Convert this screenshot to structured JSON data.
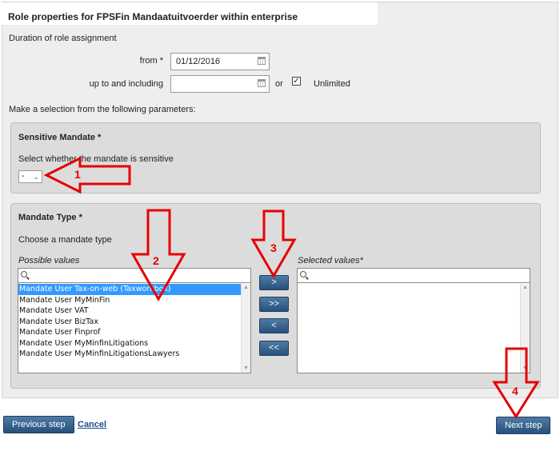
{
  "header": {
    "title": "Role properties for FPSFin Mandaatuitvoerder within enterprise"
  },
  "duration": {
    "label": "Duration of role assignment",
    "from_label": "from *",
    "from_value": "01/12/2016",
    "until_label": "up to and including",
    "until_value": "",
    "or_label": "or",
    "unlimited_label": "Unlimited",
    "unlimited_checked": true
  },
  "parameters_label": "Make a selection from the following parameters:",
  "sensitive": {
    "title": "Sensitive Mandate *",
    "description": "Select whether the mandate is sensitive",
    "selected": "-"
  },
  "mandate_type": {
    "title": "Mandate Type *",
    "description": "Choose a mandate type",
    "possible_label": "Possible values",
    "selected_label": "Selected values*",
    "possible_values": [
      "Mandate User Tax-on-web (Taxworkbox)",
      "Mandate User MyMinFin",
      "Mandate User VAT",
      "Mandate User BizTax",
      "Mandate User Finprof",
      "Mandate User MyMinfinLitigations",
      "Mandate User MyMinfinLitigationsLawyers"
    ],
    "selected_values": [],
    "buttons": {
      "add": ">",
      "add_all": ">>",
      "remove": "<",
      "remove_all": "<<"
    }
  },
  "footer": {
    "previous_label": "Previous step",
    "cancel_label": "Cancel",
    "next_label": "Next step"
  },
  "annotations": [
    "1",
    "2",
    "3",
    "4"
  ],
  "colors": {
    "button": "#2d5a87",
    "annotation": "#e60000",
    "selection": "#3399ff"
  }
}
